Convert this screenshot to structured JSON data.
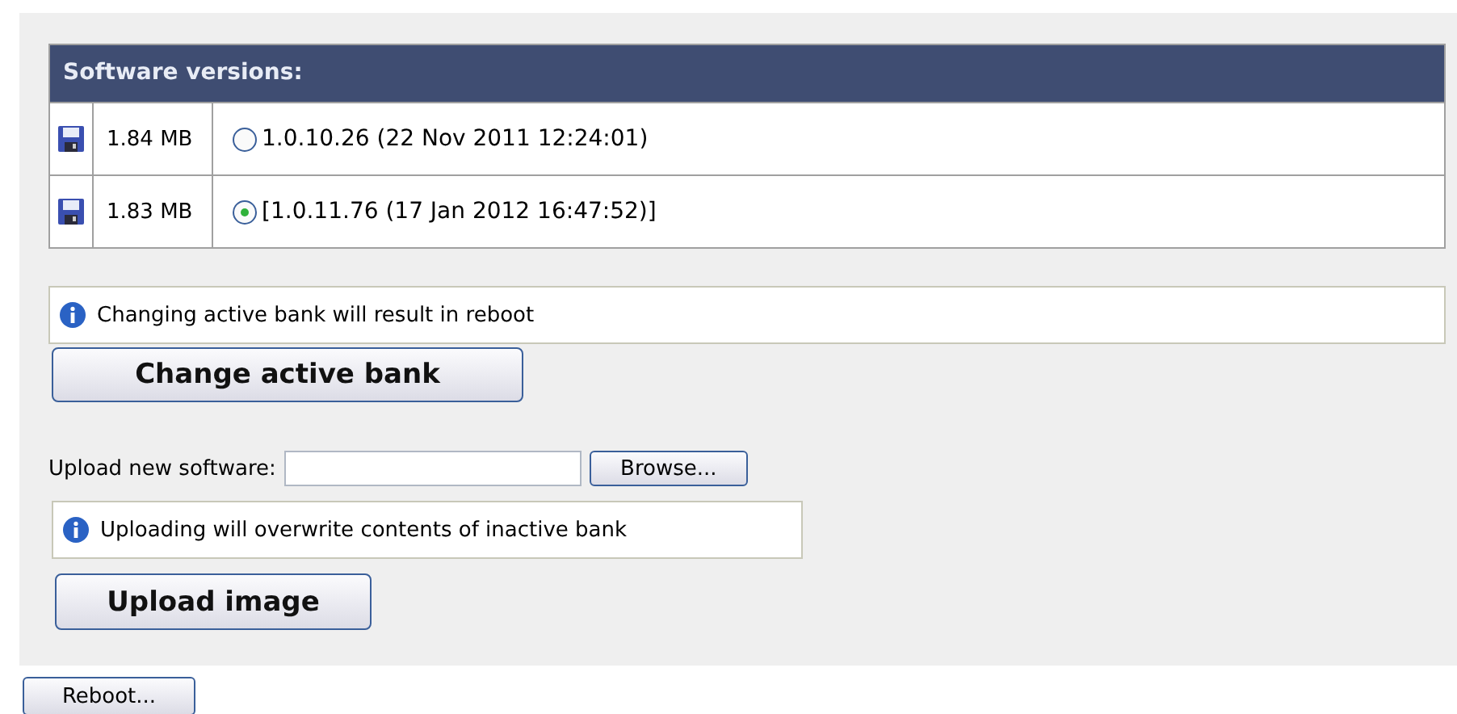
{
  "versions_table": {
    "title": "Software versions:",
    "rows": [
      {
        "size": "1.84 MB",
        "version": "1.0.10.26 (22 Nov 2011 12:24:01)",
        "selected": false
      },
      {
        "size": "1.83 MB",
        "version": "[1.0.11.76 (17 Jan 2012 16:47:52)]",
        "selected": true
      }
    ]
  },
  "bank_notice": "Changing active bank will result in reboot",
  "change_button": "Change active bank",
  "upload": {
    "label": "Upload new software:",
    "browse_button": "Browse...",
    "notice": "Uploading will overwrite contents of inactive bank",
    "upload_button": "Upload image"
  },
  "reboot_button": "Reboot..."
}
